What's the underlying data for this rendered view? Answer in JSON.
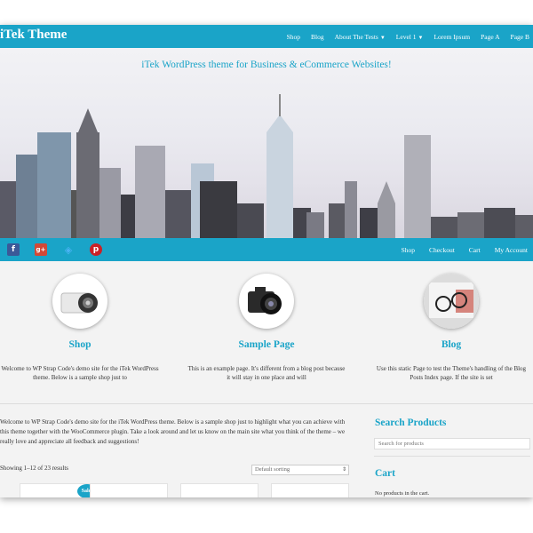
{
  "header": {
    "brand": "iTek Theme",
    "nav": [
      {
        "label": "Shop",
        "dropdown": false
      },
      {
        "label": "Blog",
        "dropdown": false
      },
      {
        "label": "About The Tests",
        "dropdown": true
      },
      {
        "label": "Level 1",
        "dropdown": true
      },
      {
        "label": "Lorem Ipsum",
        "dropdown": false
      },
      {
        "label": "Page A",
        "dropdown": false
      },
      {
        "label": "Page B",
        "dropdown": false
      }
    ]
  },
  "hero": {
    "tagline": "iTek WordPress theme for Business & eCommerce Websites!"
  },
  "social": {
    "icons": [
      "facebook-icon",
      "google-plus-icon",
      "twitter-icon",
      "pinterest-icon"
    ],
    "facebook": "f",
    "googleplus": "g+",
    "twitter": "🐦",
    "pinterest": "p"
  },
  "shopnav": [
    "Shop",
    "Checkout",
    "Cart",
    "My Account"
  ],
  "features": [
    {
      "title": "Shop",
      "text": "Welcome to WP Strap Code's demo site for the iTek WordPress theme. Below is a sample shop just to",
      "image": "camera-image"
    },
    {
      "title": "Sample Page",
      "text": "This is an example page. It's different from a blog post because it will stay in one place and will",
      "image": "camera-image"
    },
    {
      "title": "Blog",
      "text": "Use this static Page to test the Theme's handling of the Blog Posts Index page. If the site is set",
      "image": "glasses-image"
    }
  ],
  "main": {
    "intro": "Welcome to WP Strap Code's demo site for the iTek WordPress theme. Below is a sample shop just to highlight what you can achieve with this theme together with the WooCommerce plugin. Take a look around and let us know on the main site what you think of the theme – we really love and appreciate all feedback and suggestions!",
    "results": "Showing 1–12 of 23 results",
    "sort": "Default sorting",
    "sale_badge": "Sale!"
  },
  "sidebar": {
    "search_title": "Search Products",
    "search_placeholder": "Search for products",
    "cart_title": "Cart",
    "cart_empty": "No products in the cart."
  },
  "colors": {
    "accent": "#1aa4c8",
    "background": "#f3f3f3",
    "facebook": "#3b5998",
    "googleplus": "#d34836",
    "pinterest": "#cb2027"
  }
}
